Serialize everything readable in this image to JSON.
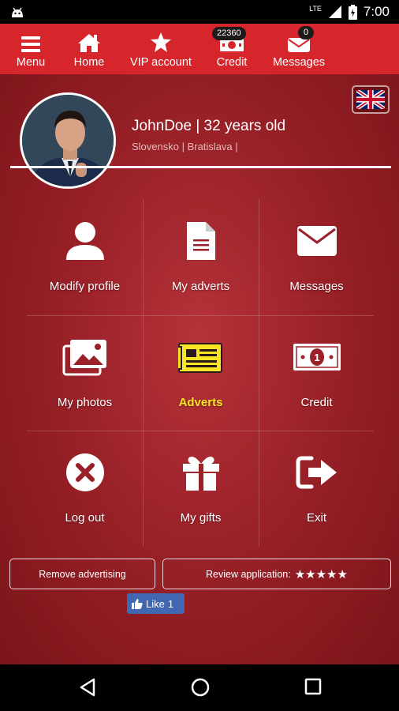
{
  "status_bar": {
    "network": "LTE",
    "time": "7:00",
    "icons": [
      "android-icon",
      "signal-icon",
      "battery-icon"
    ]
  },
  "top_nav": {
    "background": "#d6262c",
    "items": [
      {
        "label": "Menu",
        "icon": "hamburger-icon"
      },
      {
        "label": "Home",
        "icon": "home-icon"
      },
      {
        "label": "VIP account",
        "icon": "star-icon"
      },
      {
        "label": "Credit",
        "icon": "banknote-icon",
        "badge": "22360"
      },
      {
        "label": "Messages",
        "icon": "envelope-icon",
        "badge": "0"
      }
    ]
  },
  "profile": {
    "name_line": "JohnDoe | 32 years old",
    "location_line": "Slovensko | Bratislava |",
    "language_flag": "uk-flag-icon"
  },
  "grid": [
    {
      "label": "Modify profile",
      "icon": "user-icon"
    },
    {
      "label": "My adverts",
      "icon": "document-icon"
    },
    {
      "label": "Messages",
      "icon": "envelope-icon"
    },
    {
      "label": "My photos",
      "icon": "photos-icon"
    },
    {
      "label": "Adverts",
      "icon": "adverts-icon",
      "active": true
    },
    {
      "label": "Credit",
      "icon": "banknote-icon"
    },
    {
      "label": "Log out",
      "icon": "close-circle-icon"
    },
    {
      "label": "My gifts",
      "icon": "gift-icon"
    },
    {
      "label": "Exit",
      "icon": "exit-icon"
    }
  ],
  "buttons": {
    "remove_advertising": "Remove advertising",
    "review_application": "Review application:",
    "review_stars": "★★★★★"
  },
  "facebook": {
    "like_label": "Like",
    "like_count": "1"
  },
  "colors": {
    "active_label": "#f7e623",
    "main_bg": "#9a2128",
    "fb_blue": "#4267b2"
  }
}
